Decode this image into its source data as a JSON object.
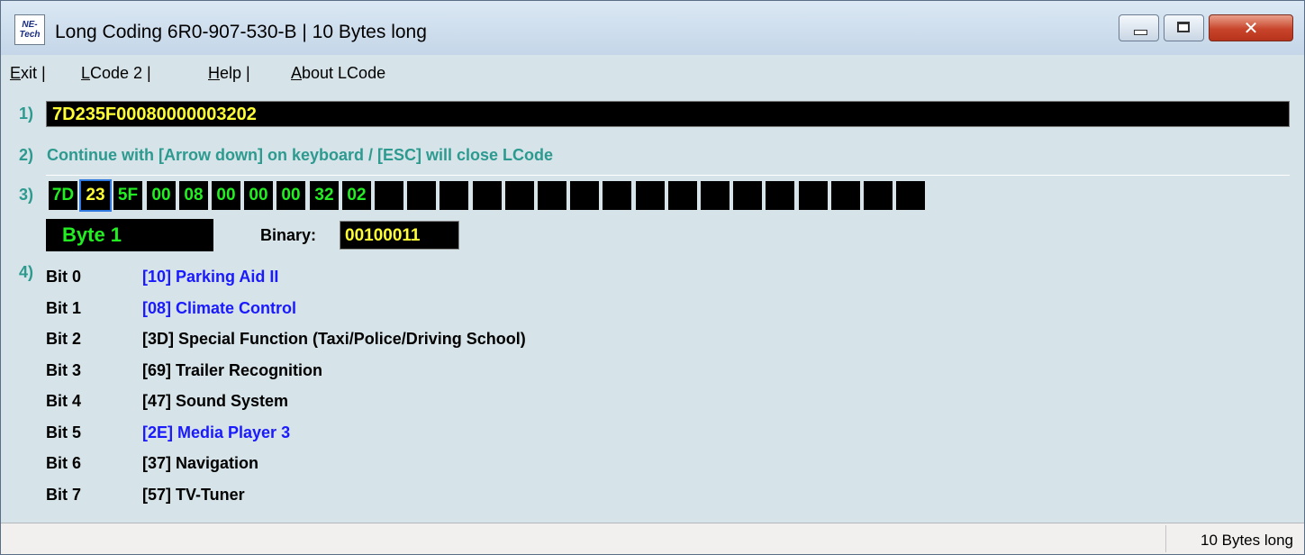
{
  "window": {
    "icon_text_top": "NE-",
    "icon_text_bottom": "Tech",
    "title": "Long Coding  6R0-907-530-B | 10 Bytes long",
    "close_glyph": "✕"
  },
  "menu": {
    "exit_accel": "E",
    "exit_rest": "xit |",
    "lcode2_accel": "L",
    "lcode2_rest": "Code 2 |",
    "help_accel": "H",
    "help_rest": "elp |",
    "about_accel": "A",
    "about_rest": "bout LCode"
  },
  "step1": {
    "num": "1)",
    "coding": "7D235F00080000003202"
  },
  "step2": {
    "num": "2)",
    "hint": "Continue with [Arrow down] on keyboard / [ESC] will close LCode"
  },
  "step3": {
    "num": "3)",
    "bytes": [
      "7D",
      "23",
      "5F",
      "00",
      "08",
      "00",
      "00",
      "00",
      "32",
      "02",
      "",
      "",
      "",
      "",
      "",
      "",
      "",
      "",
      "",
      "",
      "",
      "",
      "",
      "",
      "",
      "",
      ""
    ],
    "selected_index": 1,
    "byte_label": "Byte 1",
    "binary_label": "Binary:",
    "binary_value": "00100011"
  },
  "step4": {
    "num": "4)",
    "bits": [
      {
        "name": "Bit 0",
        "desc": "[10] Parking Aid II",
        "active": true
      },
      {
        "name": "Bit 1",
        "desc": "[08] Climate Control",
        "active": true
      },
      {
        "name": "Bit 2",
        "desc": "[3D] Special Function (Taxi/Police/Driving School)",
        "active": false
      },
      {
        "name": "Bit 3",
        "desc": "[69] Trailer Recognition",
        "active": false
      },
      {
        "name": "Bit 4",
        "desc": "[47] Sound System",
        "active": false
      },
      {
        "name": "Bit 5",
        "desc": "[2E] Media Player 3",
        "active": true
      },
      {
        "name": "Bit 6",
        "desc": "[37] Navigation",
        "active": false
      },
      {
        "name": "Bit 7",
        "desc": "[57] TV-Tuner",
        "active": false
      }
    ]
  },
  "status": {
    "text": "10 Bytes long"
  },
  "colors": {
    "active_bit": "#1a1aff",
    "inactive_bit": "#000000",
    "hint": "#2d9a90",
    "byte_green": "#22ee22",
    "byte_yellow": "#ffff33"
  }
}
